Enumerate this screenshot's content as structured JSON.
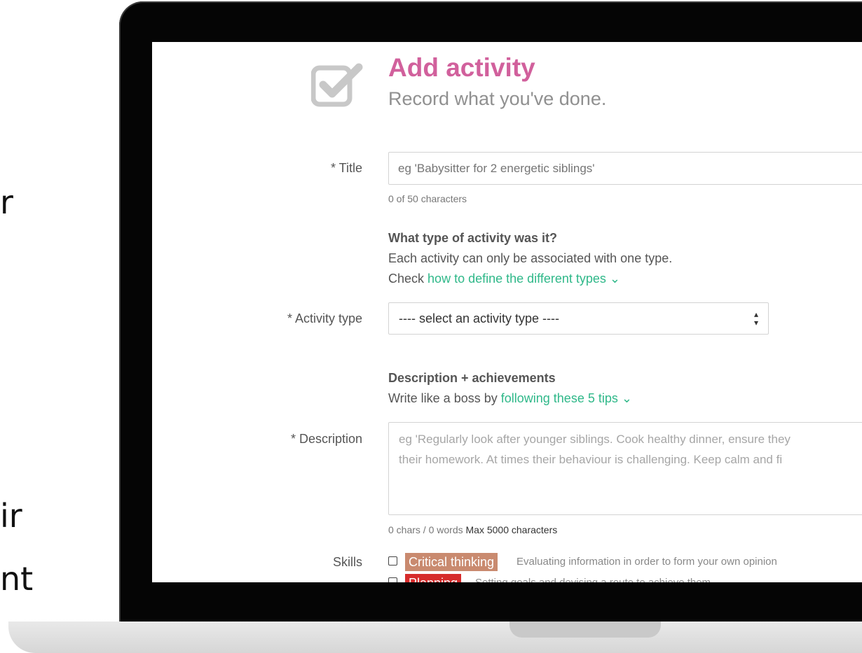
{
  "slide_fragments": [
    "r",
    "ir",
    "nt"
  ],
  "page": {
    "title": "Add activity",
    "subtitle": "Record what you've done."
  },
  "title_field": {
    "label": "* Title",
    "placeholder": "eg 'Babysitter for 2 energetic siblings'",
    "counter": "0 of 50 characters"
  },
  "activity_type_section": {
    "heading": "What type of activity was it?",
    "line1": "Each activity can only be associated with one type.",
    "line2_prefix": "Check",
    "line2_link": "how to define the different types ⌄"
  },
  "activity_type_field": {
    "label": "* Activity type",
    "selected": "---- select an activity type ----"
  },
  "description_section": {
    "heading": "Description + achievements",
    "line_prefix": "Write like a boss by",
    "line_link": "following these 5 tips ⌄"
  },
  "description_field": {
    "label": "* Description",
    "placeholder": "eg 'Regularly look after younger siblings. Cook healthy dinner, ensure they\ntheir homework. At times their behaviour is challenging. Keep calm and fi",
    "counter": "0 chars / 0 words",
    "max": "Max 5000 characters"
  },
  "skills": {
    "label": "Skills",
    "items": [
      {
        "name": "Critical thinking",
        "description": "Evaluating information in order to form your own opinion",
        "color": "#c98a6f",
        "checked": false
      },
      {
        "name": "Planning",
        "description": "Setting goals and devising a route to achieve them",
        "color": "#d62b2b",
        "checked": false
      }
    ]
  },
  "colors": {
    "title": "#d1609c",
    "link": "#2fb889",
    "bezel": "#050505"
  }
}
